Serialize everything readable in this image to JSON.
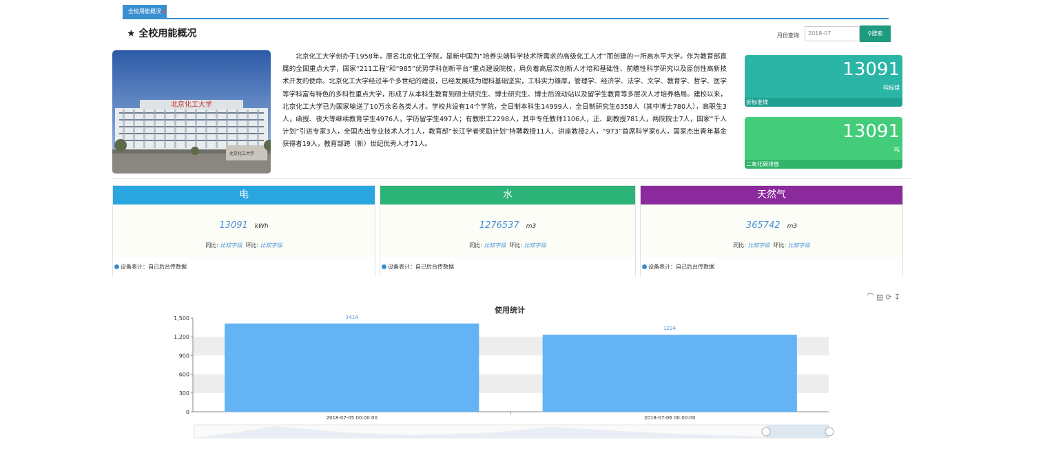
{
  "tab": {
    "label": "全校用能概况",
    "close": "x"
  },
  "page_title": "★ 全校用能概况",
  "month_query": {
    "label": "月份查询",
    "value": "2018-07",
    "button": "搜索"
  },
  "photo": {
    "sign_text": "北京化工大学"
  },
  "intro": "北京化工大学创办于1958年，原名北京化工学院，是新中国为“培养尖端科学技术所需求的高级化工人才”而创建的一所高水平大学。作为教育部直属的全国重点大学，国家“211工程”和“985”优势学科创新平台“重点建设院校，肩负着高层次创新人才培和基础性、前瞻性科学研究以及原创性高新技术开发的使命。北京化工大学经过半个多世纪的建设，已经发展成为理科基础坚实，工科实力雄厚，管理学、经济学、法学、文学、教育学、哲学、医学等学科富有特色的多科性重点大学，形成了从本科生教育到硕士研究生、博士研究生、博士后流动站以及留学生教育等多层次人才培养格局。建校以来，北京化工大学已为国家输送了10万余名各类人才。学校共设有14个学院，全日制本科生14999人，全日制研究生6358人（其中博士780人），高职生3人，函授、夜大等继续教育学生4976人，学历留学生497人；有教职工2298人，其中专任教师1106人，正、副教授781人，两院院士7人，国家“千人计划”引进专家3人，全国杰出专业技术人才1人，教育部“长江学者奖励计划”特聘教授11人、讲座教授2人，“973”首席科学家6人，国家杰出青年基金获得者19人，教育部跨（新）世纪优秀人才71人。",
  "kpis": [
    {
      "value": "13091",
      "unit": "吨标煤",
      "label": "折标准煤",
      "color": "#2bb5a6"
    },
    {
      "value": "13091",
      "unit": "吨",
      "label": "二氧化碳排放",
      "color": "#43cd7b"
    }
  ],
  "panels": [
    {
      "title": "电",
      "value": "13091",
      "unit": "kWh",
      "yoy_label": "同比:",
      "yoy_value": "比较字段",
      "mom_label": "环比:",
      "mom_value": "比较字段",
      "footer": "设备表计：自己后台传数据",
      "color": "#29a6e0"
    },
    {
      "title": "水",
      "value": "1276537",
      "unit": "m3",
      "yoy_label": "同比:",
      "yoy_value": "比较字段",
      "mom_label": "环比:",
      "mom_value": "比较字段",
      "footer": "设备表计：自己后台传数据",
      "color": "#2bb378"
    },
    {
      "title": "天然气",
      "value": "365742",
      "unit": "m3",
      "yoy_label": "同比:",
      "yoy_value": "比较字段",
      "mom_label": "环比:",
      "mom_value": "比较字段",
      "footer": "设备表计：自己后台传数据",
      "color": "#8a2a9c"
    }
  ],
  "toolbox": [
    "line-chart-icon",
    "bar-chart-icon",
    "restore-icon",
    "download-icon"
  ],
  "chart_data": {
    "type": "bar",
    "title": "使用统计",
    "categories": [
      "2018-07-05 00:00:00",
      "2018-07-06 00:00:00"
    ],
    "values": [
      1414,
      1234
    ],
    "value_labels": [
      "1414",
      "1234"
    ],
    "ylim": [
      0,
      1500
    ],
    "yticks": [
      "0",
      "300",
      "600",
      "900",
      "1,200",
      "1,500"
    ],
    "bar_color": "#63b3f5",
    "grid": true,
    "dataZoom": true
  }
}
